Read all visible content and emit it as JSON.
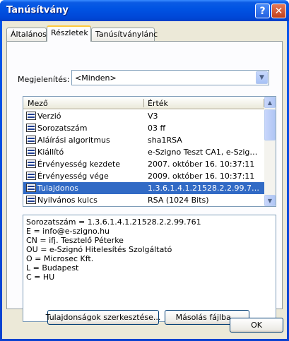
{
  "window": {
    "title": "Tanúsítvány",
    "help_label": "?",
    "close_label": "✕"
  },
  "tabs": [
    {
      "label": "Általános"
    },
    {
      "label": "Részletek"
    },
    {
      "label": "Tanúsítványlánc"
    }
  ],
  "show": {
    "label": "Megjelenítés:",
    "value": "<Minden>"
  },
  "list": {
    "columns": [
      "Mező",
      "Érték"
    ],
    "rows": [
      {
        "field": "Verzió",
        "value": "V3"
      },
      {
        "field": "Sorozatszám",
        "value": "03 ff"
      },
      {
        "field": "Aláírási algoritmus",
        "value": "sha1RSA"
      },
      {
        "field": "Kiállító",
        "value": "e-Szigno Teszt CA1, e-Szigno ..."
      },
      {
        "field": "Érvényesség kezdete",
        "value": "2007. október 16. 10:37:11"
      },
      {
        "field": "Érvényesség vége",
        "value": "2009. október 16. 10:37:11"
      },
      {
        "field": "Tulajdonos",
        "value": "1.3.6.1.4.1.21528.2.2.99.76..."
      },
      {
        "field": "Nyilvános kulcs",
        "value": "RSA (1024 Bits)"
      }
    ],
    "selected_index": 6
  },
  "detail": {
    "lines": [
      "Sorozatszám = 1.3.6.1.4.1.21528.2.2.99.761",
      "E = info@e-szigno.hu",
      "CN = ifj. Tesztelő Péterke",
      "OU = e-Szignó Hitelesítés Szolgáltató",
      "O = Microsec Kft.",
      "L = Budapest",
      "C = HU"
    ]
  },
  "buttons": {
    "edit": "Tulajdonságok szerkesztése...",
    "copy": "Másolás fájlba...",
    "ok": "OK"
  }
}
